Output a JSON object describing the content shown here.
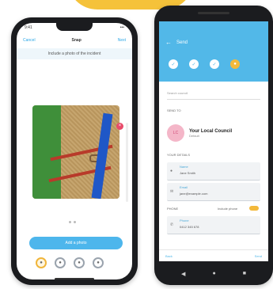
{
  "ios": {
    "status_time": "9:41",
    "status_icons": "•••",
    "nav_left": "Cancel",
    "nav_title": "Snap",
    "nav_right": "Next",
    "prompt": "Include a photo of the incident",
    "delete_glyph": "×",
    "add_button": "Add a photo",
    "steps": [
      {
        "glyph": "●",
        "icon": "camera-step-icon",
        "active": true
      },
      {
        "glyph": "●",
        "icon": "location-step-icon",
        "active": false
      },
      {
        "glyph": "●",
        "icon": "details-step-icon",
        "active": false
      },
      {
        "glyph": "●",
        "icon": "send-step-icon",
        "active": false
      }
    ]
  },
  "android": {
    "back_glyph": "←",
    "title": "Send",
    "steps": [
      {
        "glyph": "✓",
        "current": false
      },
      {
        "glyph": "✓",
        "current": false
      },
      {
        "glyph": "✓",
        "current": false
      },
      {
        "glyph": "●",
        "current": true
      }
    ],
    "search_placeholder": "Search council",
    "recipient_section": "SEND TO",
    "council_name": "Your Local Council",
    "council_sub": "Default",
    "council_initials": "LC",
    "details_section": "YOUR DETAILS",
    "name_label": "Name",
    "name_value": "Jane Smith",
    "email_label": "Email",
    "email_value": "jane@example.com",
    "phone_section": "PHONE",
    "phone_toggle_label": "Include phone",
    "phone_label": "Phone",
    "phone_value": "0412 345 678",
    "bottom_left": "Back",
    "bottom_right": "Send",
    "nav_icons": [
      "◀",
      "●",
      "■"
    ],
    "accent_color": "#52b8e8",
    "highlight_color": "#f3b93b"
  }
}
